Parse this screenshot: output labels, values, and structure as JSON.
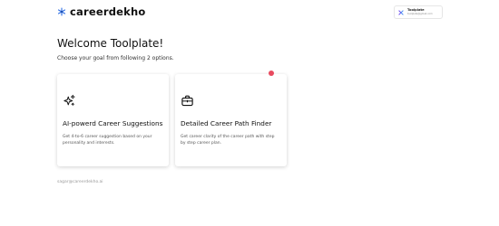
{
  "header": {
    "logo_text": "careerdekho",
    "user": {
      "name": "Toolplate",
      "email": "toolplate@gmail.com"
    }
  },
  "main": {
    "title": "Welcome Toolplate!",
    "subtitle": "Choose your goal from following 2 options.",
    "cards": [
      {
        "icon": "sparkles-icon",
        "title": "AI-powerd Career Suggestions",
        "description": "Get 4-to-6 career suggestion based on your personality and interests."
      },
      {
        "icon": "briefcase-icon",
        "title": "Detailed Career Path Finder",
        "description": "Get career clarity of the career path with step by step career plan."
      }
    ]
  },
  "footer": {
    "email": "sagar@careerdekho.ai"
  },
  "colors": {
    "accent_logo": "#2f6fe4",
    "notification": "#e84a5f",
    "avatar_purple": "#6a4cf0"
  }
}
